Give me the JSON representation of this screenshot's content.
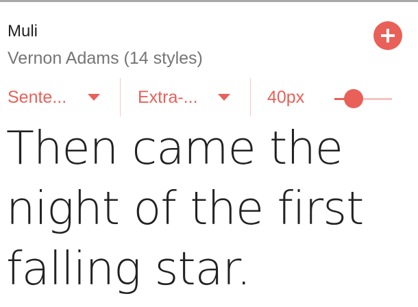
{
  "font": {
    "name": "Muli",
    "designer": "Vernon Adams (14 styles)"
  },
  "add_button": {
    "icon": "plus-icon"
  },
  "controls": {
    "sentence_label": "Sente...",
    "weight_label": "Extra-...",
    "size_label": "40px",
    "size_slider_fraction": 0.33
  },
  "preview": {
    "text": "Then came the night of the first falling star."
  },
  "colors": {
    "accent": "#e96058",
    "accent_light": "#f6c4c1",
    "title": "#222222",
    "subtitle": "#757575"
  }
}
